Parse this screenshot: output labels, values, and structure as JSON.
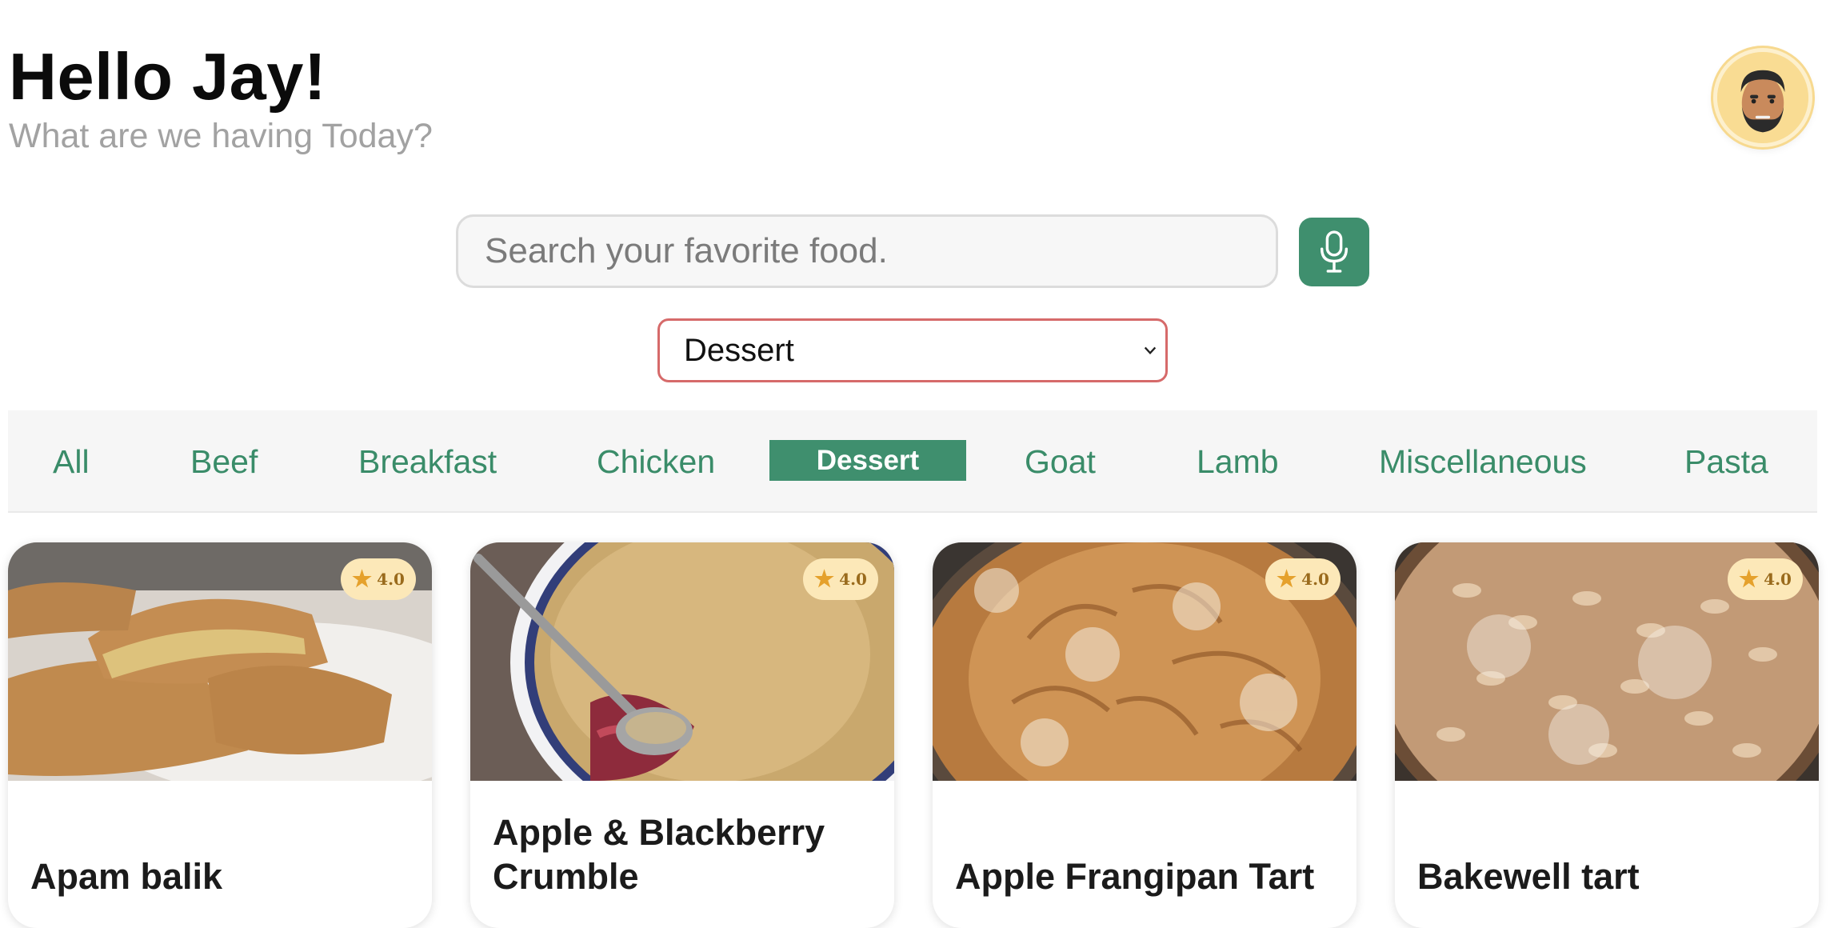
{
  "header": {
    "greeting": "Hello Jay!",
    "subtitle": "What are we having Today?",
    "avatar_icon": "user-avatar-icon"
  },
  "search": {
    "placeholder": "Search your favorite food.",
    "value": "",
    "mic_icon": "microphone-icon"
  },
  "filter": {
    "selected": "Dessert"
  },
  "categories": {
    "items": [
      "All",
      "Beef",
      "Breakfast",
      "Chicken",
      "Dessert",
      "Goat",
      "Lamb",
      "Miscellaneous",
      "Pasta"
    ],
    "active": "Dessert"
  },
  "meals": [
    {
      "name": "Apam balik",
      "rating": "4.0"
    },
    {
      "name": "Apple & Blackberry Crumble",
      "rating": "4.0"
    },
    {
      "name": "Apple Frangipan Tart",
      "rating": "4.0"
    },
    {
      "name": "Bakewell tart",
      "rating": "4.0"
    }
  ],
  "colors": {
    "accent": "#3f8f6e",
    "select_border": "#d66a6a",
    "rating_bg": "#fce8b8",
    "star": "#e5a12c"
  }
}
